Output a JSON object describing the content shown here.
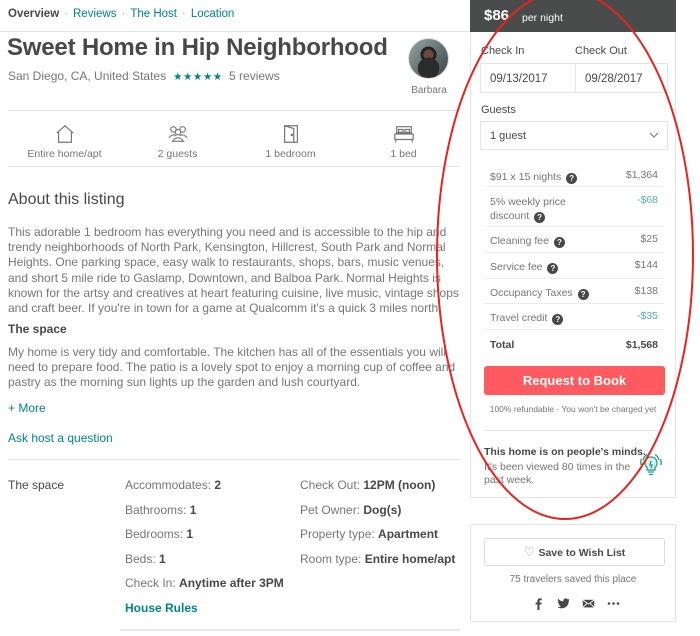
{
  "subnav": {
    "items": [
      {
        "label": "Overview",
        "active": true
      },
      {
        "label": "Reviews",
        "active": false
      },
      {
        "label": "The Host",
        "active": false
      },
      {
        "label": "Location",
        "active": false
      }
    ],
    "separator": "·"
  },
  "listing": {
    "title": "Sweet Home in Hip Neighborhood",
    "location": "San Diego, CA, United States",
    "rating_stars": 5,
    "stars_glyph": "★★★★★",
    "reviews_label": "5 reviews",
    "host_name": "Barbara"
  },
  "amenities": [
    {
      "icon": "home-icon",
      "label": "Entire home/apt"
    },
    {
      "icon": "guests-icon",
      "label": "2 guests"
    },
    {
      "icon": "door-icon",
      "label": "1 bedroom"
    },
    {
      "icon": "bed-icon",
      "label": "1 bed"
    }
  ],
  "about": {
    "heading": "About this listing",
    "description": "This adorable 1 bedroom has everything you need and is accessible to the hip and trendy neighborhoods of North Park, Kensington, Hillcrest, South Park and Normal Heights. One parking space, easy walk to restaurants, shops, bars, music venues, and short 5 mile ride to Gaslamp, Downtown, and Balboa Park. Normal Heights is known for the artsy and creatives at heart featuring cuisine, live music, vintage shops and craft beer. If you're in town for a game at Qualcomm it's a quick 3 miles north.",
    "space_heading": "The space",
    "space_text": "My home is very tidy and comfortable. The kitchen has all of the essentials you will need to prepare food. The patio is a lovely spot to enjoy a morning cup of coffee and pastry as the morning sun lights up the garden and lush courtyard.",
    "more_link": "+ More",
    "ask_host_link": "Ask host a question"
  },
  "space_details": {
    "label": "The space",
    "col1": [
      {
        "key": "Accommodates:",
        "value": "2"
      },
      {
        "key": "Bathrooms:",
        "value": "1"
      },
      {
        "key": "Bedrooms:",
        "value": "1"
      },
      {
        "key": "Beds:",
        "value": "1"
      },
      {
        "key": "Check In:",
        "value": "Anytime after 3PM"
      }
    ],
    "col2": [
      {
        "key": "Check Out:",
        "value": "12PM (noon)"
      },
      {
        "key": "Pet Owner:",
        "value": "Dog(s)"
      },
      {
        "key": "Property type:",
        "value": "Apartment"
      },
      {
        "key": "Room type:",
        "value": "Entire home/apt"
      }
    ],
    "house_rules_link": "House Rules"
  },
  "booking": {
    "price": "$86",
    "price_suffix": "per night",
    "check_in_label": "Check In",
    "check_out_label": "Check Out",
    "check_in_value": "09/13/2017",
    "check_out_value": "09/28/2017",
    "guests_label": "Guests",
    "guests_value": "1 guest",
    "fees": [
      {
        "label": "$91 x 15 nights",
        "value": "$1,364",
        "credit": false
      },
      {
        "label": "5% weekly price discount",
        "value": "-$68",
        "credit": true
      },
      {
        "label": "Cleaning fee",
        "value": "$25",
        "credit": false
      },
      {
        "label": "Service fee",
        "value": "$144",
        "credit": false
      },
      {
        "label": "Occupancy Taxes",
        "value": "$138",
        "credit": false
      },
      {
        "label": "Travel credit",
        "value": "-$35",
        "credit": true
      }
    ],
    "help_glyph": "?",
    "total_label": "Total",
    "total_value": "$1,568",
    "book_button": "Request to Book",
    "refund_note": "100% refundable · You won't be charged yet",
    "minds_title": "This home is on people's minds.",
    "minds_text": "It's been viewed 80 times in the past week."
  },
  "wishlist": {
    "button_label": "Save to Wish List",
    "heart_glyph": "♡",
    "saved_count": "75 travelers saved this place",
    "share_icons": [
      "facebook-icon",
      "twitter-icon",
      "email-icon",
      "more-icon"
    ]
  },
  "colors": {
    "accent_teal": "#008489",
    "book_red": "#ff5a5f",
    "price_bar": "#4a4c4c",
    "credit_teal": "#4fb4a7",
    "annotation_red": "#e8231d"
  }
}
